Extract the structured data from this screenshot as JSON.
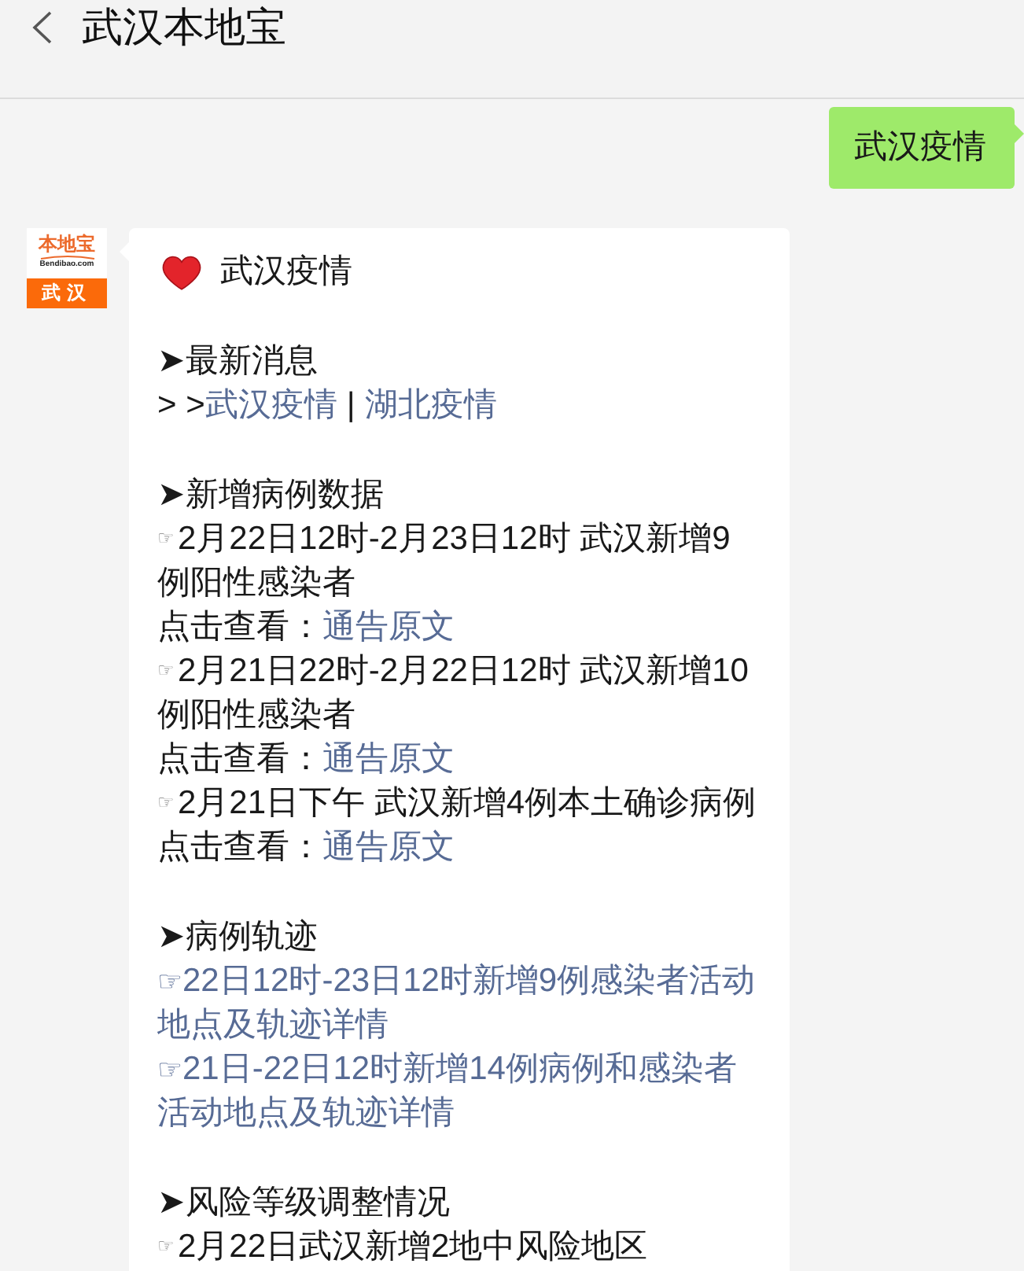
{
  "header": {
    "title": "武汉本地宝"
  },
  "outgoing": {
    "text": "武汉疫情"
  },
  "incoming": {
    "avatar": {
      "brand": "本地宝",
      "domain": "Bendibao.com",
      "city": "武汉"
    },
    "title": "武汉疫情",
    "sections": [
      {
        "heading": "➤最新消息",
        "lines": [
          {
            "kind": "links",
            "prefix": "> >",
            "links": [
              {
                "text": "武汉疫情"
              },
              {
                "text": "湖北疫情"
              }
            ],
            "separator": "|"
          }
        ]
      },
      {
        "heading": "➤新增病例数据",
        "lines": [
          {
            "kind": "item",
            "bullet": "☞",
            "text": "2月22日12时-2月23日12时 武汉新增9例阳性感染者"
          },
          {
            "kind": "source",
            "label": "点击查看：",
            "link": "通告原文"
          },
          {
            "kind": "item",
            "bullet": "☞",
            "text": "2月21日22时-2月22日12时 武汉新增10例阳性感染者"
          },
          {
            "kind": "source",
            "label": "点击查看：",
            "link": "通告原文"
          },
          {
            "kind": "item",
            "bullet": "☞",
            "text": "2月21日下午 武汉新增4例本土确诊病例"
          },
          {
            "kind": "source",
            "label": "点击查看：",
            "link": "通告原文"
          }
        ]
      },
      {
        "heading": "➤病例轨迹",
        "lines": [
          {
            "kind": "link",
            "bullet": "☞",
            "text": "22日12时-23日12时新增9例感染者活动地点及轨迹详情"
          },
          {
            "kind": "link",
            "bullet": "☞",
            "text": "21日-22日12时新增14例病例和感染者活动地点及轨迹详情"
          }
        ]
      },
      {
        "heading": "➤风险等级调整情况",
        "lines": [
          {
            "kind": "item",
            "bullet": "☞",
            "text": "2月22日武汉新增2地中风险地区"
          }
        ]
      }
    ]
  }
}
